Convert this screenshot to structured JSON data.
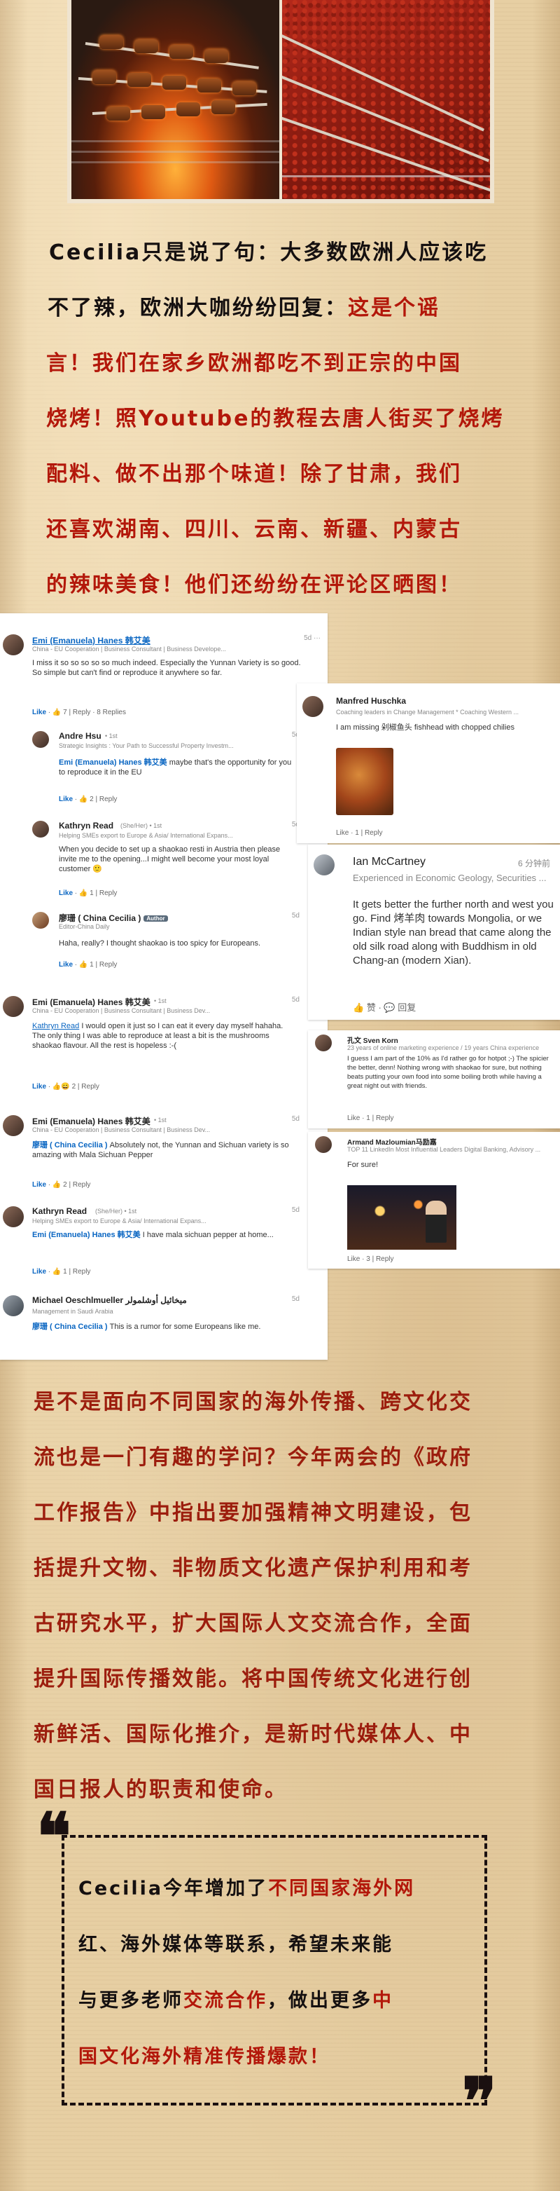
{
  "intro": {
    "lines": [
      [
        {
          "t": "Cecilia只是说了句：大多数欧洲人应该吃",
          "c": "black"
        }
      ],
      [
        {
          "t": "不了辣，欧洲大咖纷纷回复：",
          "c": "black"
        },
        {
          "t": "这是个谣",
          "c": "red"
        }
      ],
      [
        {
          "t": "言！我们在家乡欧洲都吃不到正宗的中国",
          "c": "red"
        }
      ],
      [
        {
          "t": "烧烤！照Youtube的教程去唐人街买了烧烤",
          "c": "red"
        }
      ],
      [
        {
          "t": "配料、做不出那个味道！除了甘肃，我们",
          "c": "red"
        }
      ],
      [
        {
          "t": "还喜欢湖南、四川、云南、新疆、内蒙古",
          "c": "red"
        }
      ],
      [
        {
          "t": "的辣味美食！他们还纷纷在评论区晒图！",
          "c": "red"
        }
      ]
    ]
  },
  "left_screenshot": {
    "comments": [
      {
        "name": "Emi (Emanuela) Hanes 韩艾美",
        "meta": "• 1st",
        "sub": "China - EU Cooperation | Business Consultant | Business Develope...",
        "time": "5d",
        "text": "I miss it so so so so so much indeed. Especially the Yunnan Variety is so good. So simple but can't find or reproduce it anywhere so far.",
        "actions": "Like · 7 | Reply · 8 Replies"
      },
      {
        "name": "Andre Hsu",
        "meta": "• 1st",
        "sub": "Strategic Insights : Your Path to Successful Property Investm...",
        "time": "5d",
        "mention": "Emi (Emanuela) Hanes 韩艾美",
        "text": " maybe that's the opportunity for you to reproduce it in the EU",
        "actions": "Like · 2 | Reply"
      },
      {
        "name": "Kathryn Read",
        "meta": "(She/Her) • 1st",
        "sub": "Helping SMEs export to Europe & Asia/ International Expans...",
        "time": "5d",
        "text": "When you decide to set up a shaokao resti in Austria then please invite me to the opening...I might well become your most loyal customer 🙂",
        "actions": "Like · 1 | Reply"
      },
      {
        "name": "廖珊 ( China Cecilia )",
        "badge": "Author",
        "meta": "",
        "sub": "Editor-China Daily",
        "time": "5d",
        "text": "Haha, really? I thought shaokao is too spicy for Europeans.",
        "actions": "Like · 1 | Reply"
      },
      {
        "name": "Emi (Emanuela) Hanes 韩艾美",
        "meta": "• 1st",
        "sub": "China - EU Cooperation | Business Consultant | Business Dev...",
        "time": "5d",
        "mention": "Kathryn Read",
        "text": " I would open it just so I can eat it every day myself hahaha. The only thing I was able to reproduce at least a bit is the mushrooms shaokao flavour. All the rest is hopeless :-(",
        "actions": "Like · 2 | Reply"
      },
      {
        "name": "Emi (Emanuela) Hanes 韩艾美",
        "meta": "• 1st",
        "sub": "China - EU Cooperation | Business Consultant | Business Dev...",
        "time": "5d",
        "mention": "廖珊 ( China Cecilia )",
        "text": " Absolutely not, the Yunnan and Sichuan variety is so amazing with Mala Sichuan Pepper",
        "actions": "Like · 2 | Reply"
      },
      {
        "name": "Kathryn Read",
        "meta": "(She/Her) • 1st",
        "sub": "Helping SMEs export to Europe & Asia/ International Expans...",
        "time": "5d",
        "mention": "Emi (Emanuela) Hanes 韩艾美",
        "text": " I have mala sichuan pepper at home...",
        "actions": "Like · 1 | Reply"
      },
      {
        "name": "Michael Oeschlmueller ميخائيل أوشلمولر",
        "meta": "",
        "sub": "Management in Saudi Arabia",
        "time": "5d",
        "mention": "廖珊 ( China Cecilia )",
        "text": " This is a rumor for some Europeans like me.",
        "actions": ""
      }
    ]
  },
  "right_screenshot": {
    "manfred": {
      "name": "Manfred Huschka",
      "sub": "Coaching leaders in Change Management * Coaching Western ...",
      "text": "I am missing 剁椒鱼头 fishhead with chopped chilies",
      "actions": "Like · 1 | Reply"
    },
    "ian": {
      "name": "Ian McCartney",
      "time": "6 分钟前",
      "sub": "Experienced in Economic Geology, Securities ...",
      "text": "It gets better the further north and west you go. Find 烤羊肉 towards Mongolia, or we Indian style nan bread that came along the old silk road along with Buddhism in old Chang-an (modern Xian).",
      "like": "赞",
      "reply": "回复"
    },
    "sven": {
      "name": "孔文 Sven Korn",
      "sub": "23 years of online marketing experience / 19 years China experience",
      "text": "I guess I am part of the 10% as I'd rather go for hotpot ;-) The spicier the better, denn! Nothing wrong with shaokao for sure, but nothing beats putting your own food into some boiling broth while having a great night out with friends.",
      "actions": "Like · 1 | Reply"
    },
    "armand": {
      "name": "Armand Mazloumian马励嘉",
      "sub": "TOP 11 LinkedIn Most Influential Leaders Digital Banking, Advisory ...",
      "text": "For sure!",
      "actions": "Like · 3 | Reply"
    }
  },
  "body": {
    "lines": [
      "是不是面向不同国家的海外传播、跨文化交",
      "流也是一门有趣的学问？今年两会的《政府",
      "工作报告》中指出要加强精神文明建设，包",
      "括提升文物、非物质文化遗产保护利用和考",
      "古研究水平，扩大国际人文交流合作，全面",
      "提升国际传播效能。将中国传统文化进行创",
      "新鲜活、国际化推介，是新时代媒体人、中",
      "国日报人的职责和使命。"
    ]
  },
  "quote": {
    "open_mark": "❝",
    "close_mark": "❞",
    "lines": [
      [
        {
          "t": "Cecilia今年增加了",
          "c": "black"
        },
        {
          "t": "不同国家海外网",
          "c": "red"
        }
      ],
      [
        {
          "t": "红、海外媒体等联系，希望未来能",
          "c": "black"
        }
      ],
      [
        {
          "t": "与更多老师",
          "c": "black"
        },
        {
          "t": "交流合作",
          "c": "red"
        },
        {
          "t": "，做出更多",
          "c": "black"
        },
        {
          "t": "中",
          "c": "red"
        }
      ],
      [
        {
          "t": "国文化海外精准传播爆款！",
          "c": "red"
        }
      ]
    ]
  },
  "colors": {
    "accent_red": "#b3170a",
    "ink": "#151010",
    "linkedin_blue": "#0a66c2",
    "paper": "#e7cfa3"
  },
  "icons": [
    "thumb-up-icon",
    "reply-icon",
    "more-dots-icon"
  ]
}
